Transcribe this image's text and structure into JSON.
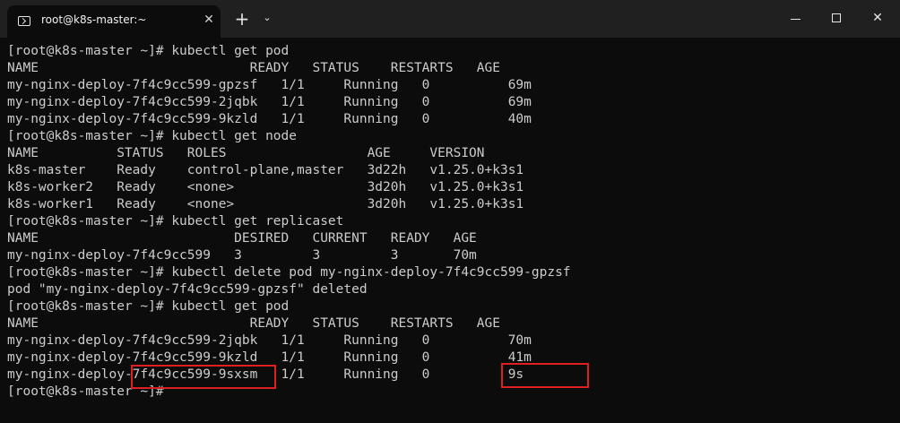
{
  "window": {
    "tab_title": "root@k8s-master:~",
    "tab_close": "✕",
    "new_tab": "+",
    "dropdown": "⌄",
    "minimize_icon": "minimize-icon",
    "maximize_icon": "maximize-icon",
    "close_glyph": "✕"
  },
  "terminal": {
    "lines": [
      "[root@k8s-master ~]# kubectl get pod",
      "NAME                           READY   STATUS    RESTARTS   AGE",
      "my-nginx-deploy-7f4c9cc599-gpzsf   1/1     Running   0          69m",
      "my-nginx-deploy-7f4c9cc599-2jqbk   1/1     Running   0          69m",
      "my-nginx-deploy-7f4c9cc599-9kzld   1/1     Running   0          40m",
      "[root@k8s-master ~]# kubectl get node",
      "NAME          STATUS   ROLES                  AGE     VERSION",
      "k8s-master    Ready    control-plane,master   3d22h   v1.25.0+k3s1",
      "k8s-worker2   Ready    <none>                 3d20h   v1.25.0+k3s1",
      "k8s-worker1   Ready    <none>                 3d20h   v1.25.0+k3s1",
      "[root@k8s-master ~]# kubectl get replicaset",
      "NAME                         DESIRED   CURRENT   READY   AGE",
      "my-nginx-deploy-7f4c9cc599   3         3         3       70m",
      "[root@k8s-master ~]# kubectl delete pod my-nginx-deploy-7f4c9cc599-gpzsf",
      "pod \"my-nginx-deploy-7f4c9cc599-gpzsf\" deleted",
      "[root@k8s-master ~]# kubectl get pod",
      "NAME                           READY   STATUS    RESTARTS   AGE",
      "my-nginx-deploy-7f4c9cc599-2jqbk   1/1     Running   0          70m",
      "my-nginx-deploy-7f4c9cc599-9kzld   1/1     Running   0          41m",
      "my-nginx-deploy-7f4c9cc599-9sxsm   1/1     Running   0          9s",
      "[root@k8s-master ~]# "
    ]
  },
  "colors": {
    "background": "#0c0c0c",
    "text": "#cccccc",
    "titlebar": "#202020",
    "highlight": "#e02020"
  }
}
